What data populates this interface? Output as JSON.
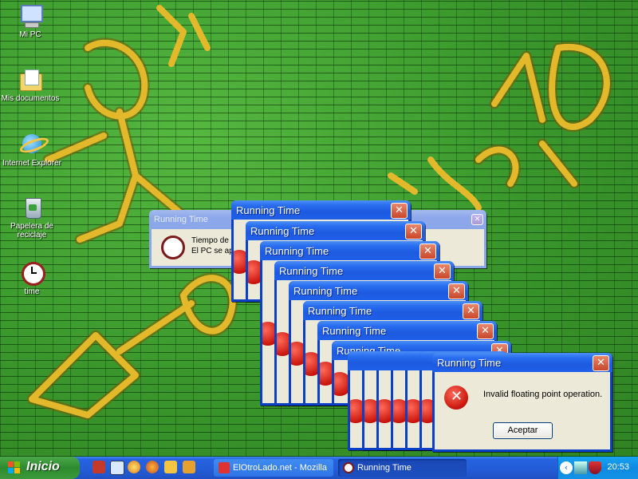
{
  "desktop": {
    "icons": [
      {
        "label": "Mi PC"
      },
      {
        "label": "Mis documentos"
      },
      {
        "label": "Internet Explorer"
      },
      {
        "label": "Papelera de reciclaje"
      },
      {
        "label": "time"
      }
    ]
  },
  "window_title": "Running Time",
  "back_dialog": {
    "title": "Running Time",
    "line1": "Tiempo de",
    "line2": "El PC se ap"
  },
  "error_dialog": {
    "title": "Running Time",
    "message": "Invalid floating point operation.",
    "ok_button": "Aceptar",
    "icon": "error-icon"
  },
  "close_glyph": "✕",
  "taskbar": {
    "start_label": "Inicio",
    "quick_launch": [
      "red-app-icon",
      "explorer-icon",
      "media-player-icon",
      "firefox-icon",
      "folder-icon",
      "misc-icon"
    ],
    "buttons": [
      {
        "label": "ElOtroLado.net - Mozilla",
        "icon": "mozilla-icon"
      },
      {
        "label": "Running Time",
        "icon": "clock-icon"
      }
    ],
    "tray_icons": [
      "arrow-icon",
      "network-icon",
      "shield-icon"
    ],
    "clock": "20:53"
  },
  "colors": {
    "wallpaper_green": "#3c9a2c",
    "graffiti_yellow": "#e3b82b",
    "titlebar_blue": "#2a6ef0",
    "taskbar_blue": "#245dd7",
    "start_green": "#3b9a3b"
  }
}
